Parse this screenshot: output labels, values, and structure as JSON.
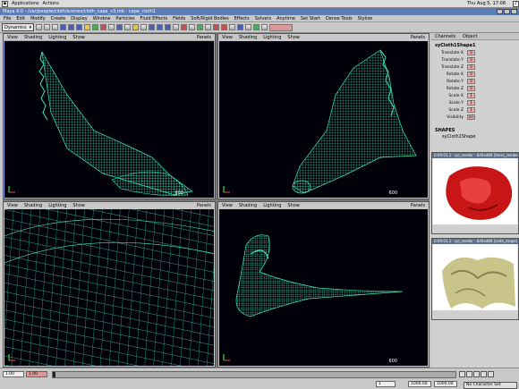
{
  "desktop": {
    "applications": "Applications",
    "actions": "Actions",
    "clock": "Thu Aug 5, 17:08"
  },
  "window": {
    "title": "Maya 4.0 - /usr/people/cloth/scenes/cloth_cape_v3.mb - cape_cloth1"
  },
  "menubar": [
    "File",
    "Edit",
    "Modify",
    "Create",
    "Display",
    "Window",
    "Particles",
    "Fluid Effects",
    "Fields",
    "Soft/Rigid Bodies",
    "Effects",
    "Solvers",
    "Anytime",
    "Set Start",
    "Dense Tools",
    "Stylize"
  ],
  "toolbar": {
    "module": "Dynamics"
  },
  "viewports": [
    {
      "menus": [
        "View",
        "Shading",
        "Lighting",
        "Show"
      ],
      "panels": "Panels",
      "frame": "600"
    },
    {
      "menus": [
        "View",
        "Shading",
        "Lighting",
        "Show"
      ],
      "panels": "Panels",
      "frame": "600"
    },
    {
      "menus": [
        "View",
        "Shading",
        "Lighting",
        "Show"
      ],
      "panels": "Panels",
      "frame": ""
    },
    {
      "menus": [
        "View",
        "Shading",
        "Lighting",
        "Show"
      ],
      "panels": "Panels",
      "frame": "600"
    }
  ],
  "channelbox": {
    "tabs": [
      "Channels",
      "Object"
    ],
    "node": "syCloth1Shape1",
    "attributes": [
      {
        "name": "Translate X",
        "value": "0"
      },
      {
        "name": "Translate Y",
        "value": "0"
      },
      {
        "name": "Translate Z",
        "value": "0"
      },
      {
        "name": "Rotate X",
        "value": "0"
      },
      {
        "name": "Rotate Y",
        "value": "0"
      },
      {
        "name": "Rotate Z",
        "value": "0"
      },
      {
        "name": "Scale X",
        "value": "1"
      },
      {
        "name": "Scale Y",
        "value": "1"
      },
      {
        "name": "Scale Z",
        "value": "1"
      },
      {
        "name": "Visibility",
        "value": "on"
      }
    ],
    "shapes_header": "SHAPES",
    "shape": "syCloth1Shape"
  },
  "renders": [
    {
      "title": "0:00:01.1 - ipr_render - 640x480 [dress_render] 1.0",
      "colors": {
        "bg": "#ffffff",
        "obj": "#c81616"
      }
    },
    {
      "title": "0:00:01.1 - ipr_render - 640x480 [cloth_drape] 1.0",
      "colors": {
        "bg": "#ffffff",
        "obj": "#c9c58a"
      }
    }
  ],
  "timeline": {
    "start": "1.00",
    "current": "1.00",
    "range_start": "1",
    "range_end": "1000.00",
    "end": "1000.00",
    "playback_end": "1000.00",
    "character_set": "No Character Set"
  },
  "colors": {
    "wire": "#3fe9b0",
    "bg": "#00000a",
    "accent": "#5b7eb6"
  }
}
